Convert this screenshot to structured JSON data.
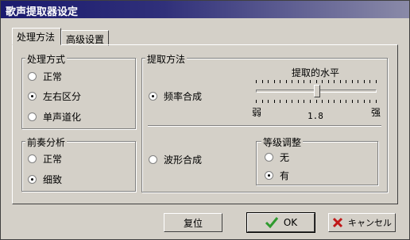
{
  "window": {
    "title": "歌声提取器设定"
  },
  "tabs": [
    {
      "label": "处理方法",
      "active": true
    },
    {
      "label": "高级设置",
      "active": false
    }
  ],
  "processing_method": {
    "label": "处理方式",
    "options": [
      {
        "label": "正常",
        "selected": false
      },
      {
        "label": "左右区分",
        "selected": true
      },
      {
        "label": "单声道化",
        "selected": false
      }
    ]
  },
  "pre_analysis": {
    "label": "前奏分析",
    "options": [
      {
        "label": "正常",
        "selected": false
      },
      {
        "label": "细致",
        "selected": true
      }
    ]
  },
  "extraction_method": {
    "label": "提取方法",
    "frequency": {
      "label": "频率合成",
      "selected": true
    },
    "waveform": {
      "label": "波形合成",
      "selected": false
    },
    "level": {
      "label": "提取的水平",
      "min_label": "弱",
      "max_label": "强",
      "value": "1.8"
    }
  },
  "grade_adjust": {
    "label": "等级调整",
    "options": [
      {
        "label": "无",
        "selected": false
      },
      {
        "label": "有",
        "selected": true
      }
    ]
  },
  "buttons": {
    "reset": "复位",
    "ok": "OK",
    "cancel": "キャンセル"
  },
  "colors": {
    "face": "#d4d0c8",
    "title_bar": "#1a1a6e",
    "ok_check": "#2e9a2e",
    "cancel_x": "#c01818"
  }
}
